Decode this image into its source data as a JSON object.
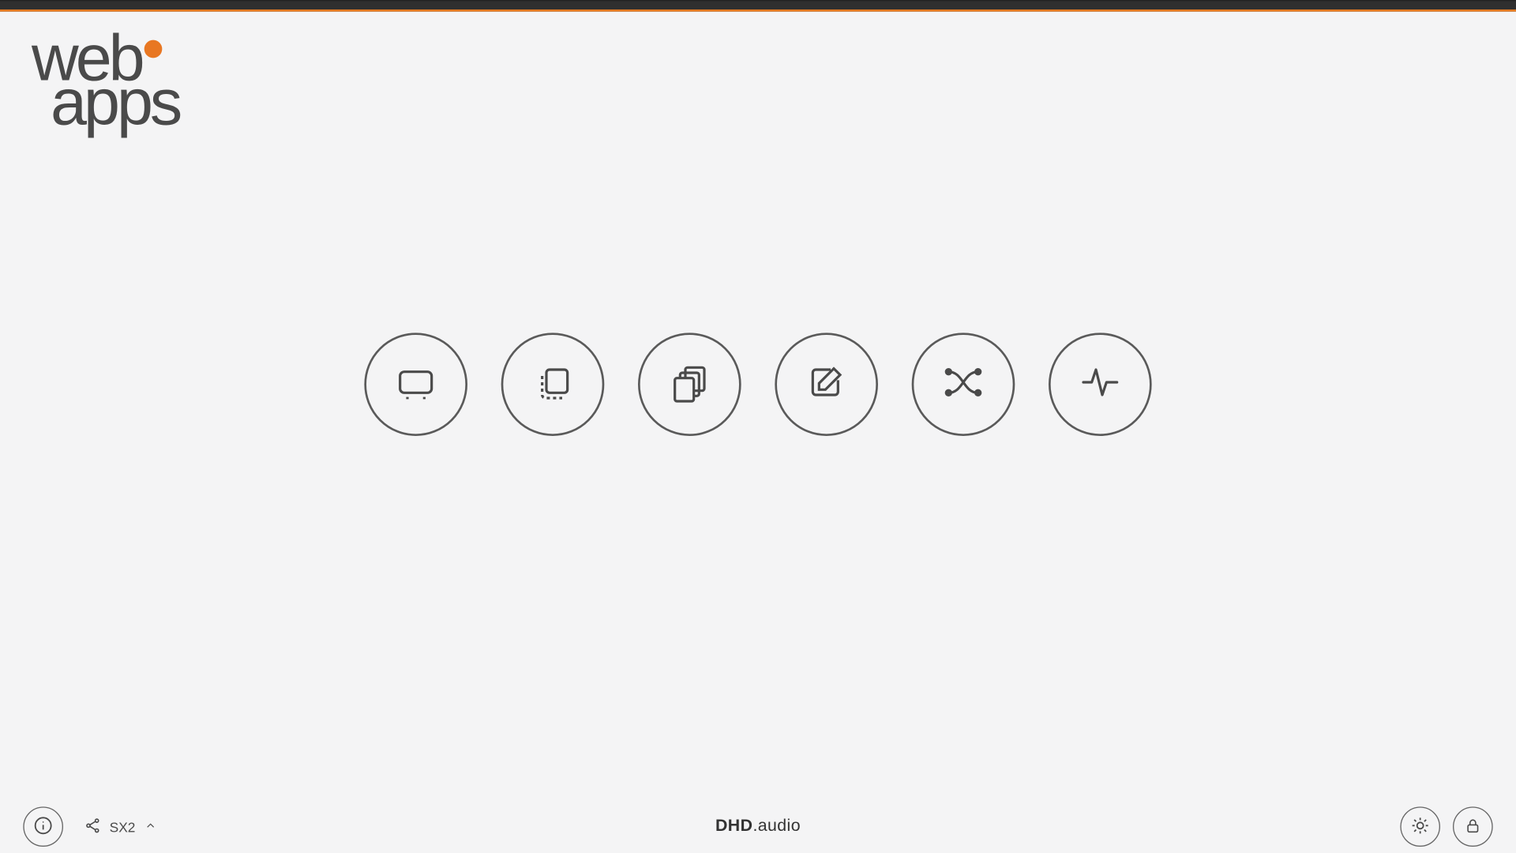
{
  "logo": {
    "line1": "web",
    "line2": "apps"
  },
  "apps": [
    {
      "icon": "monitor-icon"
    },
    {
      "icon": "snapshot-icon"
    },
    {
      "icon": "pages-icon"
    },
    {
      "icon": "edit-icon"
    },
    {
      "icon": "routing-icon"
    },
    {
      "icon": "activity-icon"
    }
  ],
  "footer": {
    "device_label": "SX2",
    "brand_bold": "DHD",
    "brand_dot_rest": ".audio"
  }
}
